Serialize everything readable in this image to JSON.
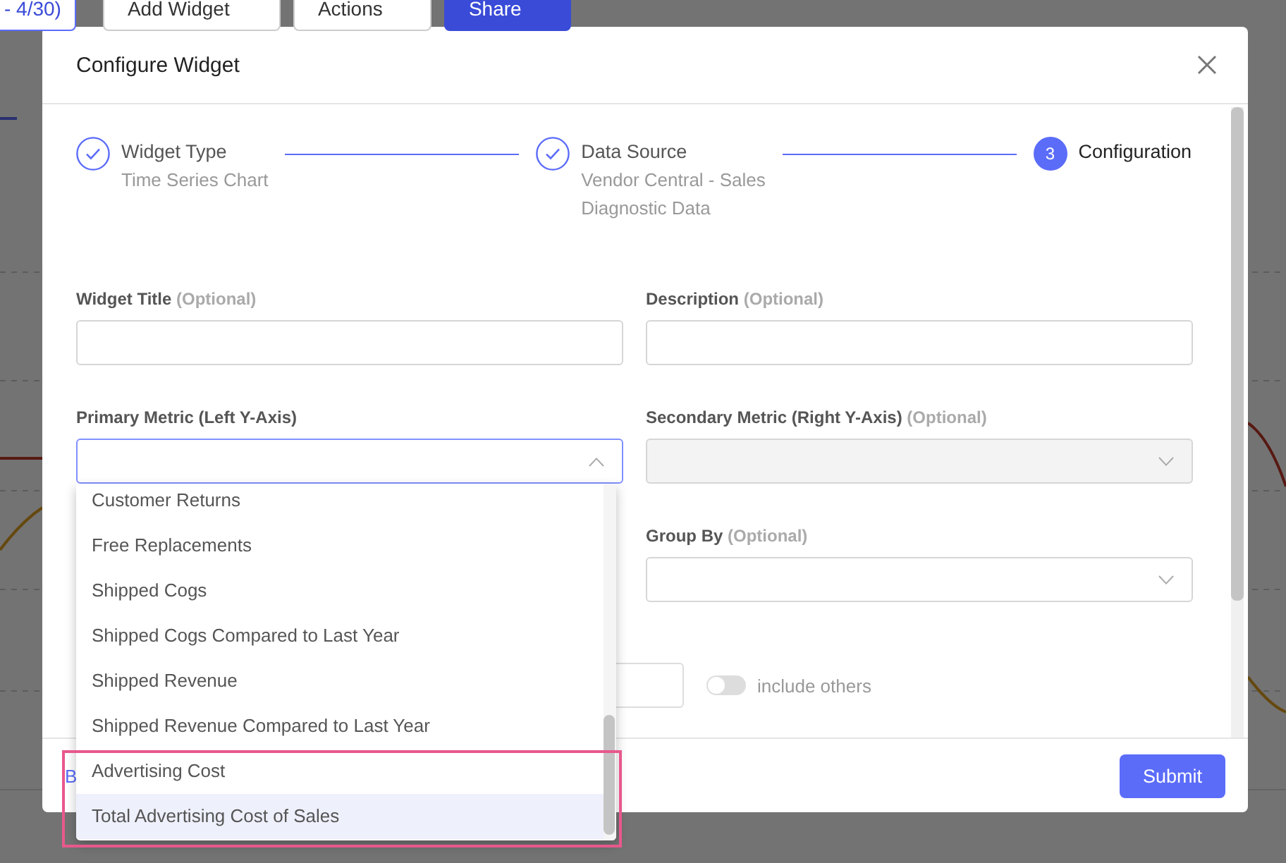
{
  "background": {
    "toolbar": [
      {
        "label": "- 4/30)",
        "kind": "range"
      },
      {
        "label": "Add Widget",
        "kind": "add"
      },
      {
        "label": "Actions",
        "kind": "menu"
      },
      {
        "label": "Share",
        "kind": "primary"
      }
    ]
  },
  "dialog": {
    "title": "Configure Widget",
    "steps": [
      {
        "label": "Widget Type",
        "details": [
          "Time Series Chart"
        ],
        "done": true,
        "active": false
      },
      {
        "label": "Data Source",
        "details": [
          "Vendor Central - Sales",
          "Diagnostic Data"
        ],
        "done": true,
        "active": false
      },
      {
        "label": "Configuration",
        "number": "3",
        "done": false,
        "active": true
      }
    ],
    "fields": [
      {
        "label": "Widget Title",
        "optional": "(Optional)",
        "kind": "text"
      },
      {
        "label": "Description",
        "optional": "(Optional)",
        "kind": "text"
      },
      {
        "label": "Primary Metric (Left Y-Axis)",
        "kind": "select",
        "open": true
      },
      {
        "label": "Secondary Metric (Right Y-Axis)",
        "optional": "(Optional)",
        "kind": "select",
        "disabled": true
      },
      {
        "kind": "hidden"
      },
      {
        "label": "Group By",
        "optional": "(Optional)",
        "kind": "select"
      }
    ],
    "toggle": {
      "label": "include others",
      "on": false
    },
    "dropdown": {
      "options": [
        {
          "label": "Customer Returns",
          "selected": false,
          "highlighted": false
        },
        {
          "label": "Free Replacements",
          "selected": false,
          "highlighted": false
        },
        {
          "label": "Shipped Cogs",
          "selected": false,
          "highlighted": false
        },
        {
          "label": "Shipped Cogs Compared to Last Year",
          "selected": false,
          "highlighted": false
        },
        {
          "label": "Shipped Revenue",
          "selected": false,
          "highlighted": false
        },
        {
          "label": "Shipped Revenue Compared to Last Year",
          "selected": false,
          "highlighted": false
        },
        {
          "label": "Advertising Cost",
          "selected": false,
          "highlighted": true
        },
        {
          "label": "Total Advertising Cost of Sales",
          "selected": true,
          "highlighted": true
        }
      ]
    },
    "back": "B",
    "submit": "Submit"
  }
}
